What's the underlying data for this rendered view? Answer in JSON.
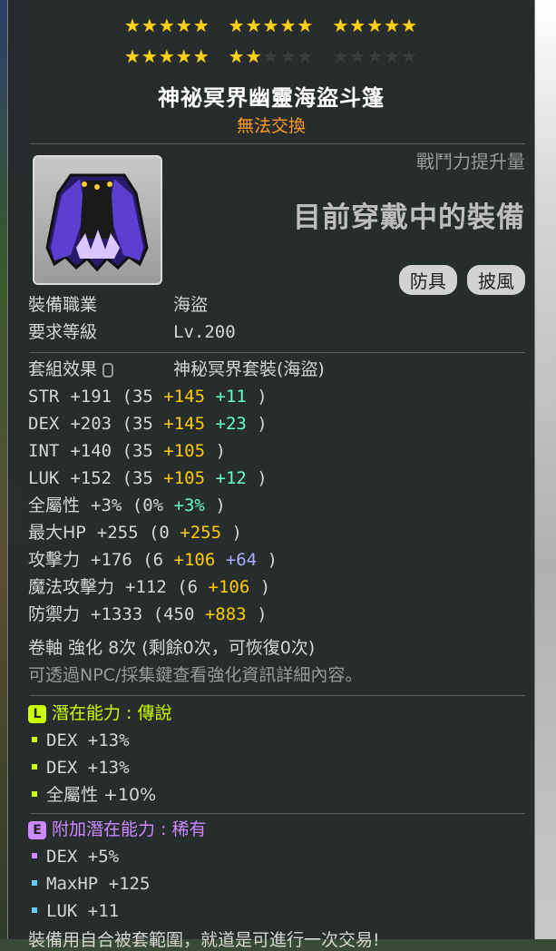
{
  "stars": {
    "rows": [
      [
        [
          "on",
          "on",
          "on",
          "on",
          "on"
        ],
        [
          "on",
          "on",
          "on",
          "on",
          "on"
        ],
        [
          "on",
          "on",
          "on",
          "on",
          "on"
        ]
      ],
      [
        [
          "on",
          "on",
          "on",
          "on",
          "on"
        ],
        [
          "on",
          "on",
          "off",
          "off",
          "off"
        ],
        [
          "off",
          "off",
          "off",
          "off",
          "off"
        ]
      ]
    ],
    "filled_count": 22,
    "total_count": 30
  },
  "item": {
    "name": "神祕冥界幽靈海盜斗篷",
    "trade_status": "無法交換",
    "icon": "purple-cape-icon"
  },
  "info": {
    "power_label": "戰鬥力提升量",
    "equipped_text": "目前穿戴中的裝備",
    "badges": [
      "防具",
      "披風"
    ]
  },
  "requirements": {
    "job_label": "裝備職業",
    "job_value": "海盜",
    "level_label": "要求等級",
    "level_value": "Lv.200"
  },
  "set": {
    "label": "套組效果",
    "value": "神秘冥界套裝(海盜)"
  },
  "stats": [
    {
      "name": "STR",
      "total": "+191",
      "base": "(35",
      "parts": [
        {
          "text": "+145",
          "color": "yellow"
        },
        {
          "text": "+11",
          "color": "cyan"
        }
      ],
      "close": ")"
    },
    {
      "name": "DEX",
      "total": "+203",
      "base": "(35",
      "parts": [
        {
          "text": "+145",
          "color": "yellow"
        },
        {
          "text": "+23",
          "color": "cyan"
        }
      ],
      "close": ")"
    },
    {
      "name": "INT",
      "total": "+140",
      "base": "(35",
      "parts": [
        {
          "text": "+105",
          "color": "yellow"
        }
      ],
      "close": ")"
    },
    {
      "name": "LUK",
      "total": "+152",
      "base": "(35",
      "parts": [
        {
          "text": "+105",
          "color": "yellow"
        },
        {
          "text": "+12",
          "color": "cyan"
        }
      ],
      "close": ")"
    },
    {
      "name": "全屬性",
      "total": "+3%",
      "base": "(0%",
      "parts": [
        {
          "text": "+3%",
          "color": "cyan"
        }
      ],
      "close": ")"
    },
    {
      "name": "最大HP",
      "total": "+255",
      "base": "(0",
      "parts": [
        {
          "text": "+255",
          "color": "yellow"
        }
      ],
      "close": ")"
    },
    {
      "name": "攻擊力",
      "total": "+176",
      "base": "(6",
      "parts": [
        {
          "text": "+106",
          "color": "yellow"
        },
        {
          "text": "+64",
          "color": "purple"
        }
      ],
      "close": ")"
    },
    {
      "name": "魔法攻擊力",
      "total": "+112",
      "base": "(6",
      "parts": [
        {
          "text": "+106",
          "color": "yellow"
        }
      ],
      "close": ")"
    },
    {
      "name": "防禦力",
      "total": "+1333",
      "base": "(450",
      "parts": [
        {
          "text": "+883",
          "color": "yellow"
        }
      ],
      "close": ")"
    }
  ],
  "scroll": {
    "text": "卷軸 強化 8次 (剩餘0次，可恢復0次)",
    "hint": "可透過NPC/採集鍵查看強化資訊詳細內容。"
  },
  "potential": {
    "badge": "L",
    "title": "潛在能力 : 傳說",
    "lines": [
      "DEX +13%",
      "DEX +13%",
      "全屬性 +10%"
    ],
    "bullet_color": "#ccff00"
  },
  "additional": {
    "badge": "E",
    "title": "附加潛在能力 : 稀有",
    "lines": [
      {
        "text": "DEX +5%",
        "bullet": "#cc88ff"
      },
      {
        "text": "MaxHP +125",
        "bullet": "#66ccff"
      },
      {
        "text": "LUK +11",
        "bullet": "#66ccff"
      }
    ]
  },
  "footer": {
    "text": "裝備用自合被套範圍，就道是可進行一次交易!"
  },
  "colors": {
    "yellow": "#ffcc00",
    "cyan": "#66ffcc",
    "purple": "#aaaaff",
    "star_on": "#ffd21a",
    "trade": "#ff9a22"
  }
}
